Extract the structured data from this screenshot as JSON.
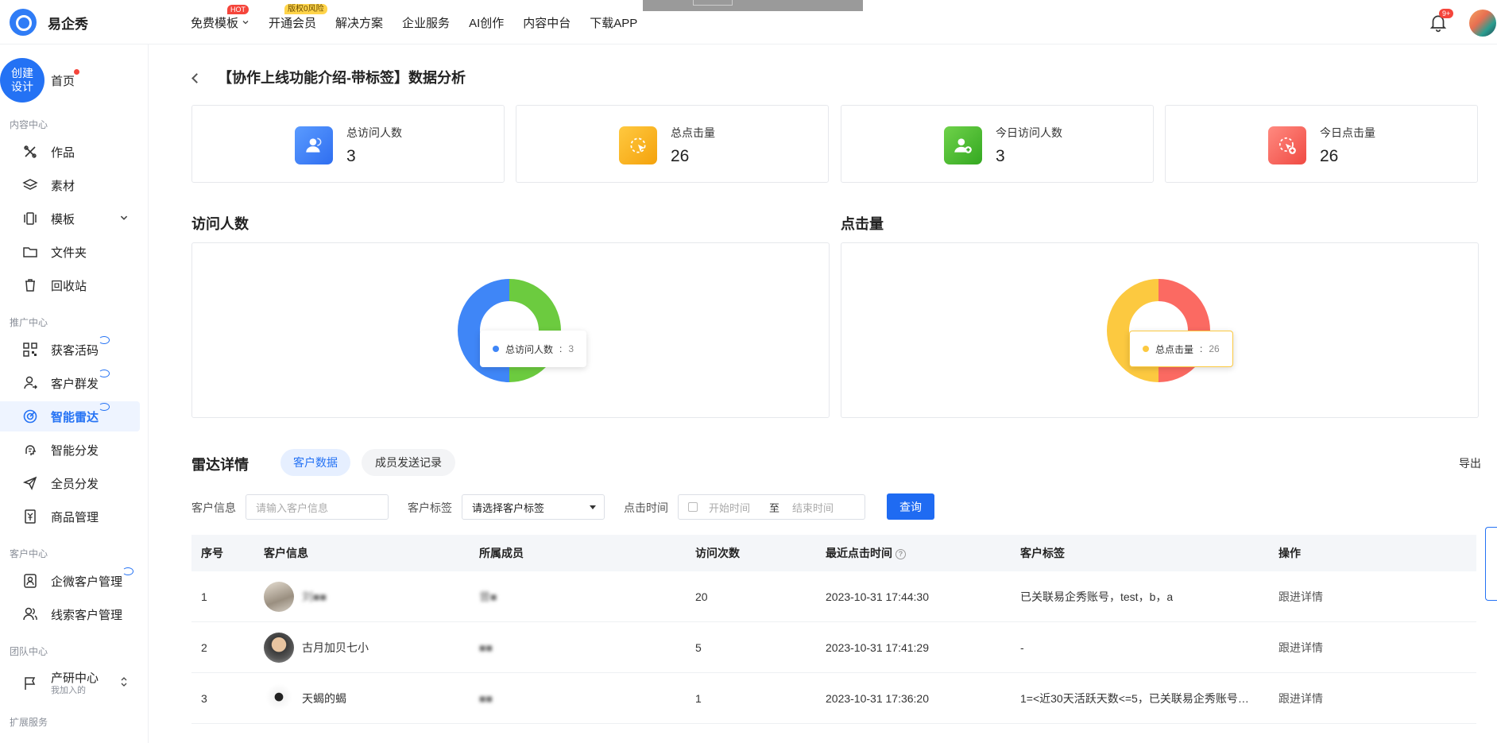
{
  "topbar": {
    "logo_text": "易企秀",
    "nav": [
      {
        "label": "免费模板",
        "badge": "HOT"
      },
      {
        "label": "开通会员",
        "badge": "版权0风险"
      },
      {
        "label": "解决方案"
      },
      {
        "label": "企业服务"
      },
      {
        "label": "AI创作"
      },
      {
        "label": "内容中台"
      },
      {
        "label": "下载APP"
      }
    ],
    "notif_count": "9+"
  },
  "sidebar": {
    "create_label": "创建\n设计",
    "home_label": "首页",
    "sections": {
      "content": "内容中心",
      "promo": "推广中心",
      "customer": "客户中心",
      "team": "团队中心",
      "ext": "扩展服务"
    },
    "items": {
      "works": "作品",
      "materials": "素材",
      "templates": "模板",
      "folder": "文件夹",
      "recycle": "回收站",
      "lead_code": "获客活码",
      "mass_send": "客户群发",
      "smart_radar": "智能雷达",
      "smart_share": "智能分发",
      "all_share": "全员分发",
      "goods": "商品管理",
      "wecom_customer": "企微客户管理",
      "lead_customer": "线索客户管理",
      "team_name": "产研中心",
      "team_sub": "我加入的"
    }
  },
  "page": {
    "title": "【协作上线功能介绍-带标签】数据分析",
    "stats": [
      {
        "label": "总访问人数",
        "value": "3"
      },
      {
        "label": "总点击量",
        "value": "26"
      },
      {
        "label": "今日访问人数",
        "value": "3"
      },
      {
        "label": "今日点击量",
        "value": "26"
      }
    ],
    "colors": {
      "blue": "#3f86f7",
      "green": "#6ccb3f",
      "yellow": "#fcc940",
      "red": "#fb6a62",
      "accent": "#1f6bf2"
    }
  },
  "chart_data": [
    {
      "type": "pie",
      "title": "访问人数",
      "donut": true,
      "slices": [
        {
          "color": "#6ccb3f",
          "value": 50
        },
        {
          "color": "#3f86f7",
          "value": 50
        }
      ],
      "tooltip": {
        "name": "总访问人数",
        "value": "3"
      }
    },
    {
      "type": "pie",
      "title": "点击量",
      "donut": true,
      "slices": [
        {
          "color": "#fb6a62",
          "value": 50
        },
        {
          "color": "#fcc940",
          "value": 50
        }
      ],
      "tooltip": {
        "name": "总点击量",
        "value": "26"
      }
    }
  ],
  "radar": {
    "title": "雷达详情",
    "tabs": [
      "客户数据",
      "成员发送记录"
    ],
    "export_label": "导出",
    "filters": {
      "customer_info_label": "客户信息",
      "customer_info_placeholder": "请输入客户信息",
      "tag_label": "客户标签",
      "tag_value": "请选择客户标签",
      "time_label": "点击时间",
      "start_placeholder": "开始时间",
      "to": "至",
      "end_placeholder": "结束时间",
      "query": "查询"
    },
    "columns": [
      "序号",
      "客户信息",
      "所属成员",
      "访问次数",
      "最近点击时间",
      "客户标签",
      "操作"
    ],
    "rows": [
      {
        "no": "1",
        "customer": "刘■■",
        "member": "曾■",
        "visits": "20",
        "last_click": "2023-10-31 17:44:30",
        "tags": "已关联易企秀账号，test，b，a",
        "action": "跟进详情"
      },
      {
        "no": "2",
        "customer": "古月加贝七小",
        "member": "■■",
        "visits": "5",
        "last_click": "2023-10-31 17:41:29",
        "tags": "-",
        "action": "跟进详情"
      },
      {
        "no": "3",
        "customer": "天蝎的蝎",
        "member": "■■",
        "visits": "1",
        "last_click": "2023-10-31 17:36:20",
        "tags": "1=<近30天活跃天数<=5，已关联易企秀账号…",
        "action": "跟进详情"
      }
    ]
  }
}
